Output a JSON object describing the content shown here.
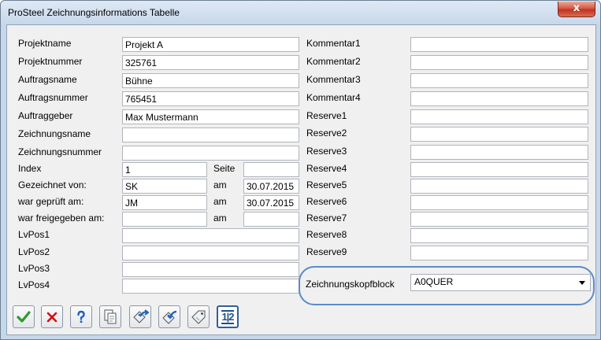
{
  "window": {
    "title": "ProSteel Zeichnungsinformations Tabelle",
    "close_glyph": "x"
  },
  "left": {
    "projektname": {
      "label": "Projektname",
      "value": "Projekt A"
    },
    "projektnummer": {
      "label": "Projektnummer",
      "value": "325761"
    },
    "auftragsname": {
      "label": "Auftragsname",
      "value": "Bühne"
    },
    "auftragsnummer": {
      "label": "Auftragsnummer",
      "value": "765451"
    },
    "auftraggeber": {
      "label": "Auftraggeber",
      "value": "Max Mustermann"
    },
    "zeichnungsname": {
      "label": "Zeichnungsname",
      "value": ""
    },
    "zeichnungsnummer": {
      "label": "Zeichnungsnummer",
      "value": ""
    },
    "index": {
      "label": "Index",
      "value": "1",
      "seite_label": "Seite",
      "seite_value": ""
    },
    "gezeichnet": {
      "label": "Gezeichnet von:",
      "value": "SK",
      "am_label": "am",
      "date": "30.07.2015"
    },
    "geprueft": {
      "label": "war geprüft am:",
      "value": "JM",
      "am_label": "am",
      "date": "30.07.2015"
    },
    "freigegeben": {
      "label": "war freigegeben am:",
      "value": "",
      "am_label": "am",
      "date": ""
    },
    "lvpos1": {
      "label": "LvPos1",
      "value": ""
    },
    "lvpos2": {
      "label": "LvPos2",
      "value": ""
    },
    "lvpos3": {
      "label": "LvPos3",
      "value": ""
    },
    "lvpos4": {
      "label": "LvPos4",
      "value": ""
    }
  },
  "right": {
    "kommentar1": {
      "label": "Kommentar1",
      "value": ""
    },
    "kommentar2": {
      "label": "Kommentar2",
      "value": ""
    },
    "kommentar3": {
      "label": "Kommentar3",
      "value": ""
    },
    "kommentar4": {
      "label": "Kommentar4",
      "value": ""
    },
    "reserve1": {
      "label": "Reserve1",
      "value": ""
    },
    "reserve2": {
      "label": "Reserve2",
      "value": ""
    },
    "reserve3": {
      "label": "Reserve3",
      "value": ""
    },
    "reserve4": {
      "label": "Reserve4",
      "value": ""
    },
    "reserve5": {
      "label": "Reserve5",
      "value": ""
    },
    "reserve6": {
      "label": "Reserve6",
      "value": ""
    },
    "reserve7": {
      "label": "Reserve7",
      "value": ""
    },
    "reserve8": {
      "label": "Reserve8",
      "value": ""
    },
    "reserve9": {
      "label": "Reserve9",
      "value": ""
    }
  },
  "zeichnungskopfblock": {
    "label": "Zeichnungskopfblock",
    "selected": "A0QUER",
    "highlight_color": "#5b8bc8"
  },
  "toolbar": {
    "icons": [
      "ok-check-icon",
      "cancel-x-icon",
      "help-icon",
      "copy-document-icon",
      "export-tag-icon",
      "import-tag-icon",
      "tag-icon",
      "numbering-icon"
    ],
    "numbering_glyph": "1|2"
  },
  "colors": {
    "ok_green": "#2e9a2e",
    "cancel_red": "#d01010",
    "help_blue": "#1d5fbf"
  }
}
